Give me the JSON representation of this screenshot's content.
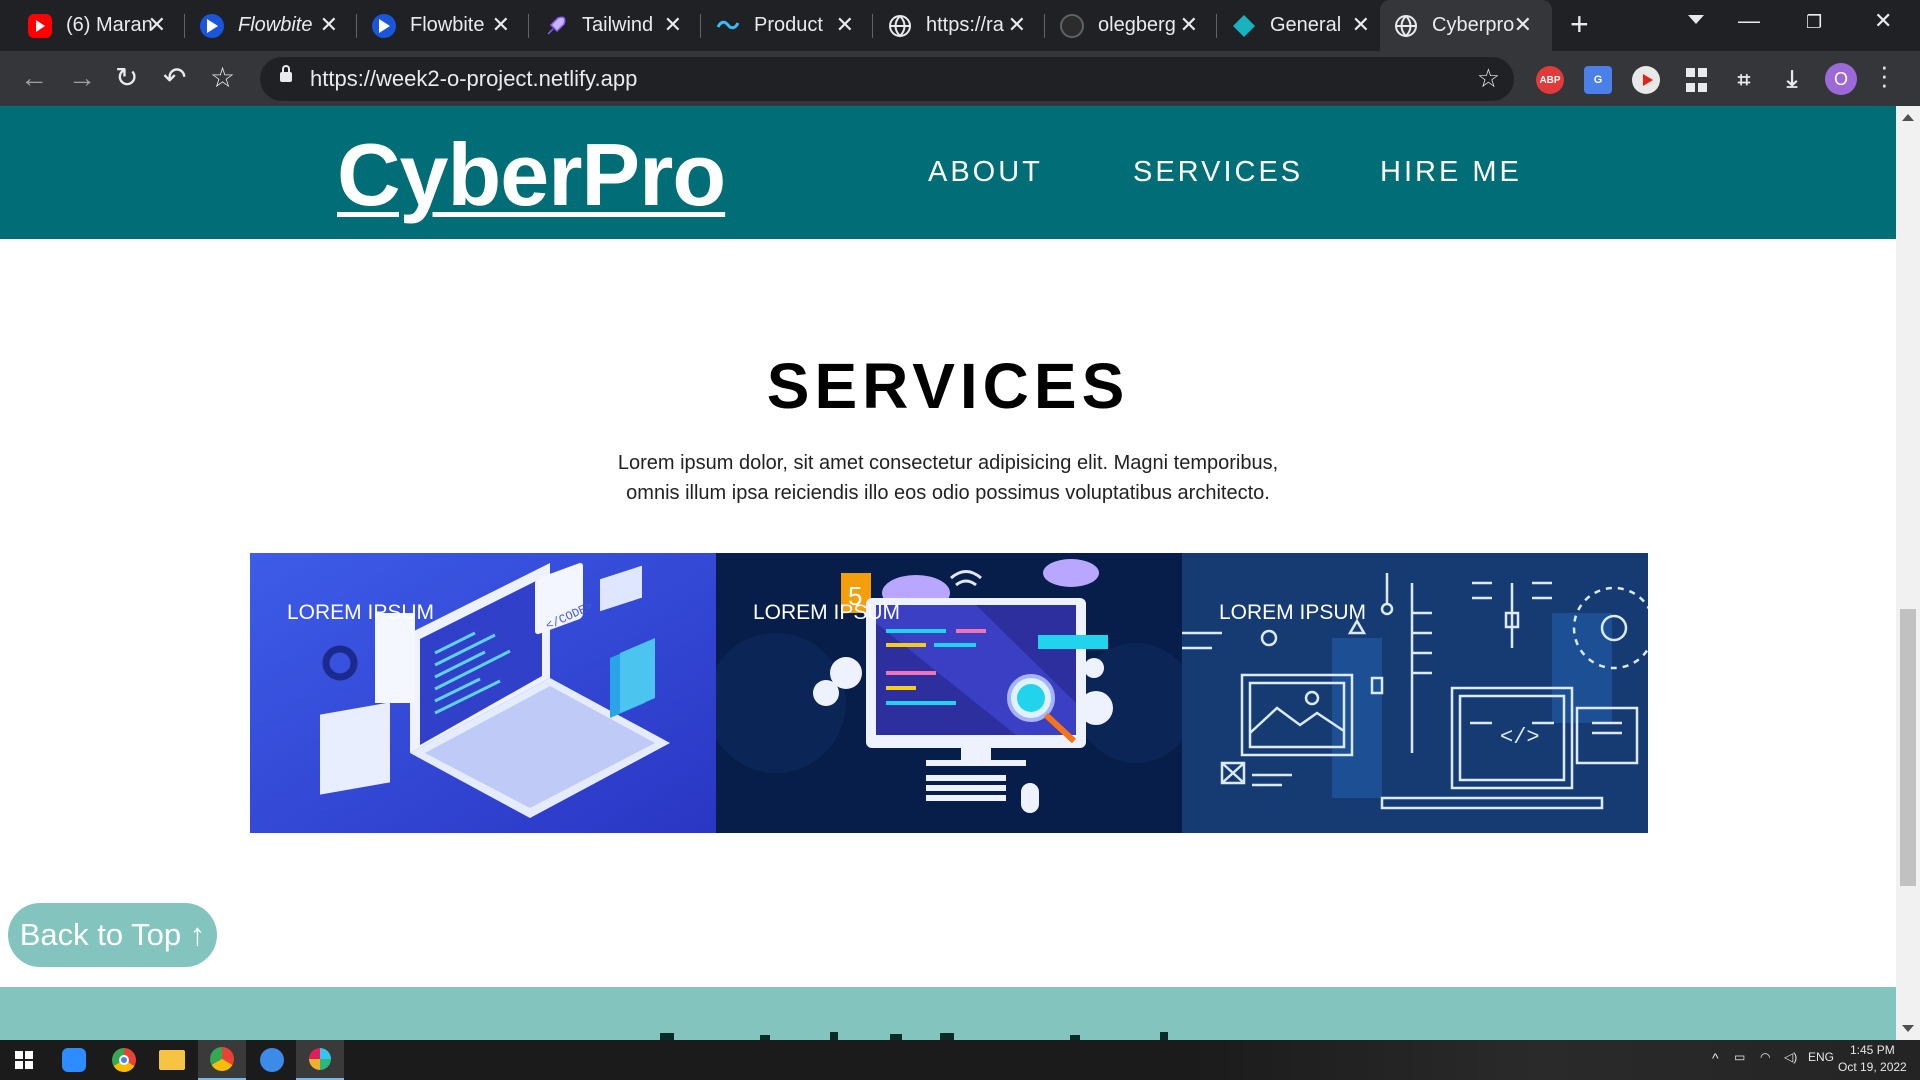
{
  "browser": {
    "tabs": [
      {
        "title": "(6) Maran",
        "favicon": "youtube-icon",
        "color": "#ff0000"
      },
      {
        "title": "Flowbite",
        "favicon": "flowbite-icon",
        "color": "#1a56db"
      },
      {
        "title": "Flowbite",
        "favicon": "flowbite-icon",
        "color": "#1a56db"
      },
      {
        "title": "Tailwind",
        "favicon": "rocket-icon",
        "color": "#8b5cf6"
      },
      {
        "title": "Product",
        "favicon": "tailwind-icon",
        "color": "#38bdf8"
      },
      {
        "title": "https://ra",
        "favicon": "globe-icon",
        "color": "#e8eaed"
      },
      {
        "title": "olegberg",
        "favicon": "github-icon",
        "color": "#202124"
      },
      {
        "title": "General",
        "favicon": "diamond-icon",
        "color": "#17b3c1"
      },
      {
        "title": "Cyberpro",
        "favicon": "globe-icon",
        "color": "#e8eaed"
      }
    ],
    "url": "https://week2-o-project.netlify.app",
    "profile_initial": "O",
    "extensions": {
      "adblock": "ABP"
    }
  },
  "site": {
    "logo": "CyberPro",
    "nav": [
      "ABOUT",
      "SERVICES",
      "HIRE ME"
    ]
  },
  "services": {
    "title": "SERVICES",
    "intro_line1": "Lorem ipsum dolor, sit amet consectetur adipisicing elit. Magni temporibus,",
    "intro_line2": "omnis illum ipsa reiciendis illo eos odio possimus voluptatibus architecto.",
    "cards": [
      {
        "label": "LOREM IPSUM",
        "bg": "#3349d6",
        "illustration": "isometric-laptop-code"
      },
      {
        "label": "LOREM IPSUM",
        "bg": "#071d4a",
        "illustration": "monitor-html5-coding"
      },
      {
        "label": "LOREM IPSUM",
        "bg": "#163b73",
        "illustration": "ui-wireframe-blueprint"
      }
    ]
  },
  "back_to_top": {
    "label": "Back to Top",
    "arrow": "↑"
  },
  "colors": {
    "header": "#006d77",
    "accent": "#83c5be"
  },
  "taskbar": {
    "language": "ENG",
    "time": "1:45 PM",
    "date": "Oct 19, 2022"
  }
}
